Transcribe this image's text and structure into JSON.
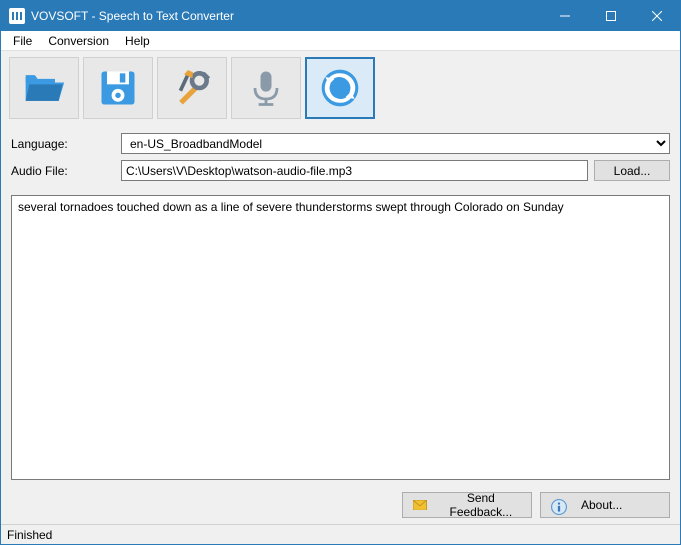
{
  "window": {
    "title": "VOVSOFT - Speech to Text Converter"
  },
  "menu": {
    "file": "File",
    "conversion": "Conversion",
    "help": "Help"
  },
  "form": {
    "language_label": "Language:",
    "language_value": "en-US_BroadbandModel",
    "audiofile_label": "Audio File:",
    "audiofile_value": "C:\\Users\\V\\Desktop\\watson-audio-file.mp3",
    "load_label": "Load..."
  },
  "output": {
    "text": "several tornadoes touched down as a line of severe thunderstorms swept through Colorado on Sunday"
  },
  "bottom": {
    "feedback": "Send Feedback...",
    "about": "About..."
  },
  "status": {
    "text": "Finished"
  }
}
